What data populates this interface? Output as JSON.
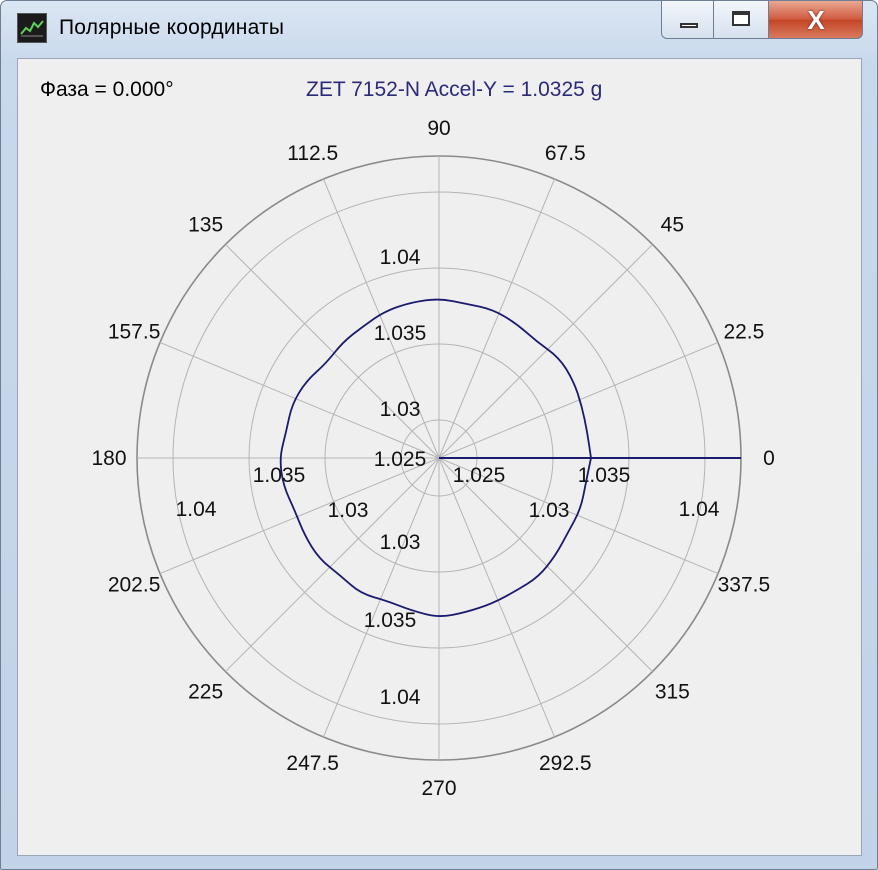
{
  "window": {
    "title": "Полярные координаты",
    "buttons": {
      "minimize_icon": "minimize-icon",
      "maximize_icon": "maximize-icon",
      "close_glyph": "X"
    }
  },
  "header": {
    "phase_text": "Фаза = 0.000°",
    "channel_text": "ZET 7152-N Accel-Y = 1.0325 g"
  },
  "chart_data": {
    "type": "polar",
    "angle_labels": [
      "0",
      "22.5",
      "45",
      "67.5",
      "90",
      "112.5",
      "135",
      "157.5",
      "180",
      "202.5",
      "225",
      "247.5",
      "270",
      "292.5",
      "315",
      "337.5"
    ],
    "radial_ticks": [
      1.025,
      1.03,
      1.035,
      1.04
    ],
    "radial_tick_labels": {
      "up": [
        "1.025",
        "1.03",
        "1.035",
        "1.04"
      ],
      "left": [
        "1.035",
        "1.04"
      ],
      "lower_left": [
        "1.03"
      ],
      "down": [
        "1.03",
        "1.035",
        "1.04"
      ],
      "right": [
        "1.025",
        "1.035",
        "1.04"
      ],
      "lower_right": [
        "1.03"
      ]
    },
    "r_range": [
      1.02,
      1.045
    ],
    "series": [
      {
        "color": "#1a1a6e",
        "angles_deg": [
          0,
          10,
          20,
          30,
          40,
          50,
          60,
          70,
          80,
          90,
          100,
          110,
          120,
          130,
          140,
          150,
          160,
          170,
          180,
          190,
          200,
          210,
          220,
          230,
          240,
          250,
          260,
          270,
          280,
          290,
          300,
          310,
          320,
          330,
          340,
          350
        ],
        "values": [
          1.0325,
          1.0324,
          1.0325,
          1.0327,
          1.0328,
          1.0325,
          1.0327,
          1.0329,
          1.0328,
          1.033,
          1.0329,
          1.0328,
          1.0325,
          1.0324,
          1.0322,
          1.0326,
          1.0328,
          1.0327,
          1.033,
          1.0329,
          1.0326,
          1.0327,
          1.0328,
          1.0326,
          1.0328,
          1.0325,
          1.0327,
          1.033,
          1.0328,
          1.0327,
          1.0326,
          1.0327,
          1.0325,
          1.0323,
          1.0324,
          1.0323
        ]
      }
    ],
    "phase_line_angle_deg": 0,
    "grid": true
  }
}
